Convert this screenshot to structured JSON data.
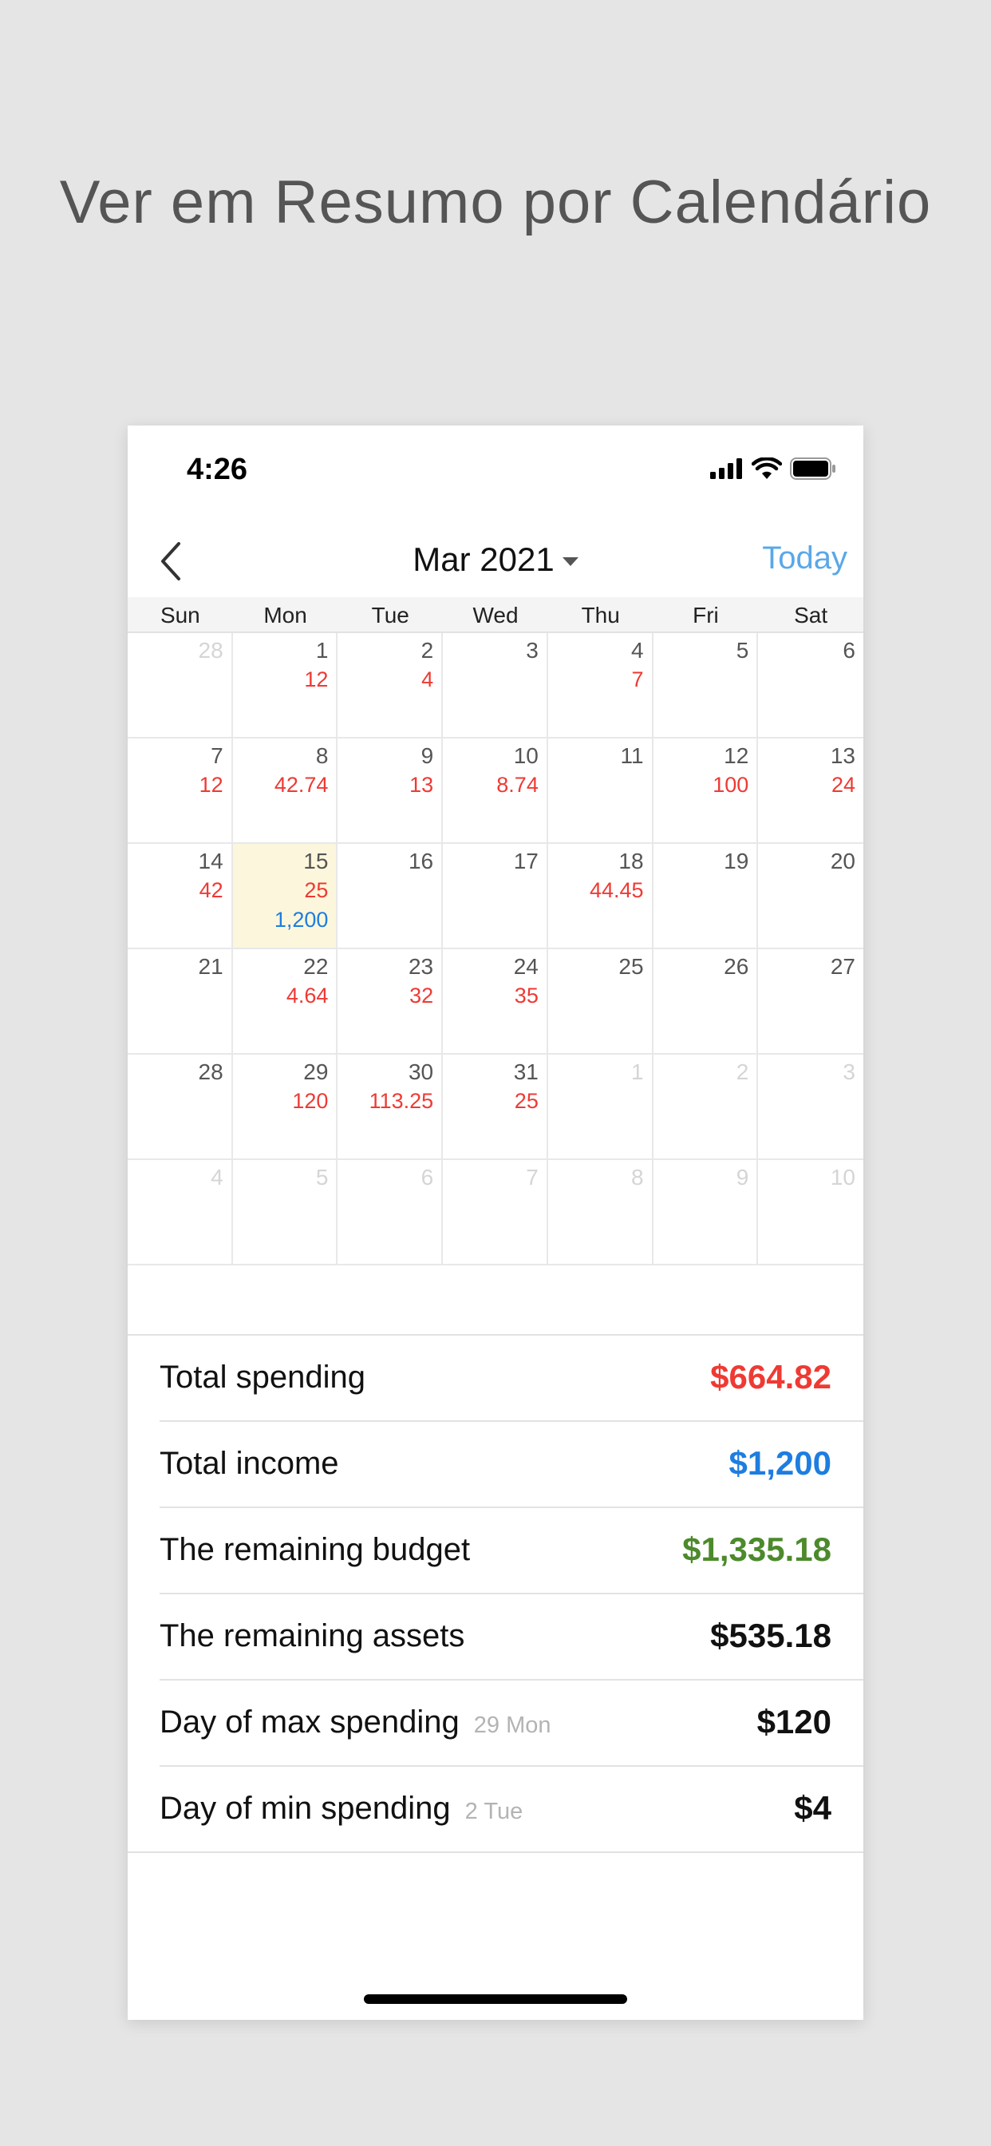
{
  "headline": "Ver em Resumo por Calendário",
  "status": {
    "time": "4:26"
  },
  "nav": {
    "month": "Mar 2021",
    "today_label": "Today"
  },
  "weekdays": [
    "Sun",
    "Mon",
    "Tue",
    "Wed",
    "Thu",
    "Fri",
    "Sat"
  ],
  "calendar": {
    "selected_day": "15",
    "cells": [
      {
        "day": "28",
        "muted": true
      },
      {
        "day": "1",
        "spend": "12"
      },
      {
        "day": "2",
        "spend": "4"
      },
      {
        "day": "3"
      },
      {
        "day": "4",
        "spend": "7"
      },
      {
        "day": "5"
      },
      {
        "day": "6"
      },
      {
        "day": "7",
        "spend": "12"
      },
      {
        "day": "8",
        "spend": "42.74"
      },
      {
        "day": "9",
        "spend": "13"
      },
      {
        "day": "10",
        "spend": "8.74"
      },
      {
        "day": "11"
      },
      {
        "day": "12",
        "spend": "100"
      },
      {
        "day": "13",
        "spend": "24"
      },
      {
        "day": "14",
        "spend": "42"
      },
      {
        "day": "15",
        "spend": "25",
        "income": "1,200",
        "selected": true
      },
      {
        "day": "16"
      },
      {
        "day": "17"
      },
      {
        "day": "18",
        "spend": "44.45"
      },
      {
        "day": "19"
      },
      {
        "day": "20"
      },
      {
        "day": "21"
      },
      {
        "day": "22",
        "spend": "4.64"
      },
      {
        "day": "23",
        "spend": "32"
      },
      {
        "day": "24",
        "spend": "35"
      },
      {
        "day": "25"
      },
      {
        "day": "26"
      },
      {
        "day": "27"
      },
      {
        "day": "28"
      },
      {
        "day": "29",
        "spend": "120"
      },
      {
        "day": "30",
        "spend": "113.25"
      },
      {
        "day": "31",
        "spend": "25"
      },
      {
        "day": "1",
        "muted": true
      },
      {
        "day": "2",
        "muted": true
      },
      {
        "day": "3",
        "muted": true
      },
      {
        "day": "4",
        "muted": true
      },
      {
        "day": "5",
        "muted": true
      },
      {
        "day": "6",
        "muted": true
      },
      {
        "day": "7",
        "muted": true
      },
      {
        "day": "8",
        "muted": true
      },
      {
        "day": "9",
        "muted": true
      },
      {
        "day": "10",
        "muted": true
      }
    ]
  },
  "summary": {
    "total_spending": {
      "label": "Total spending",
      "value": "$664.82"
    },
    "total_income": {
      "label": "Total income",
      "value": "$1,200"
    },
    "remaining_budget": {
      "label": "The remaining budget",
      "value": "$1,335.18"
    },
    "remaining_assets": {
      "label": "The remaining assets",
      "value": "$535.18"
    },
    "max_day": {
      "label": "Day of max spending",
      "sub": "29 Mon",
      "value": "$120"
    },
    "min_day": {
      "label": "Day of min spending",
      "sub": "2 Tue",
      "value": "$4"
    }
  },
  "colors": {
    "spend": "#ef3a33",
    "income": "#1e7de0",
    "budget": "#4c8a2c",
    "today": "#5aa8e8",
    "selected_bg": "#fcf7dc"
  },
  "icons": [
    "signal-icon",
    "wifi-icon",
    "battery-icon",
    "back-chevron-icon",
    "caret-down-icon"
  ]
}
